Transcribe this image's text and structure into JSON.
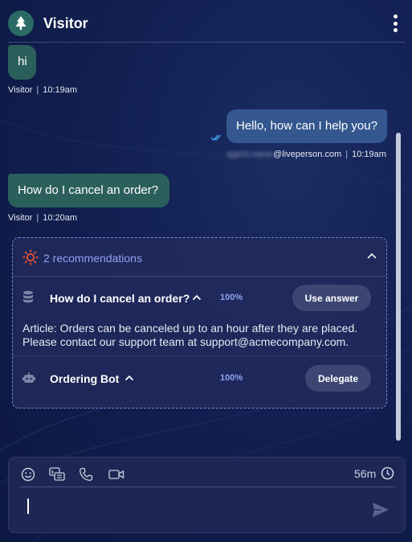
{
  "header": {
    "title": "Visitor"
  },
  "messages": [
    {
      "from": "visitor",
      "text": "hi",
      "sender": "Visitor",
      "time": "10:19am"
    },
    {
      "from": "agent",
      "text": "Hello, how can I help you?",
      "sender_hidden": "agent.name",
      "sender_domain": "@liveperson.com",
      "time": "10:19am"
    },
    {
      "from": "visitor",
      "text": "How do I cancel an order?",
      "sender": "Visitor",
      "time": "10:20am"
    }
  ],
  "recommendations": {
    "title": "2 recommendations",
    "items": [
      {
        "title": "How do I cancel an order?",
        "confidence": "100%",
        "action": "Use answer",
        "body": "Article: Orders can be canceled up to an hour after they are placed. Please contact our support team at support@acmecompany.com."
      },
      {
        "title": "Ordering Bot",
        "confidence": "100%",
        "action": "Delegate"
      }
    ]
  },
  "composer": {
    "timer": "56m",
    "placeholder": ""
  },
  "icons": {
    "avatar": "tree-icon",
    "menu": "kebab-menu-icon",
    "read": "double-check-icon",
    "recommendations": "sun-icon",
    "collapse": "chevron-up-icon",
    "article": "database-icon",
    "bot": "bot-icon",
    "emoji": "emoji-icon",
    "canned": "canned-response-icon",
    "call": "phone-icon",
    "video": "video-icon",
    "timer": "clock-icon",
    "send": "send-icon"
  },
  "colors": {
    "visitor_bubble": "#2b5f5c",
    "agent_bubble": "#34578f",
    "accent": "#8fa3f0",
    "read_check": "#4aa8ff"
  }
}
